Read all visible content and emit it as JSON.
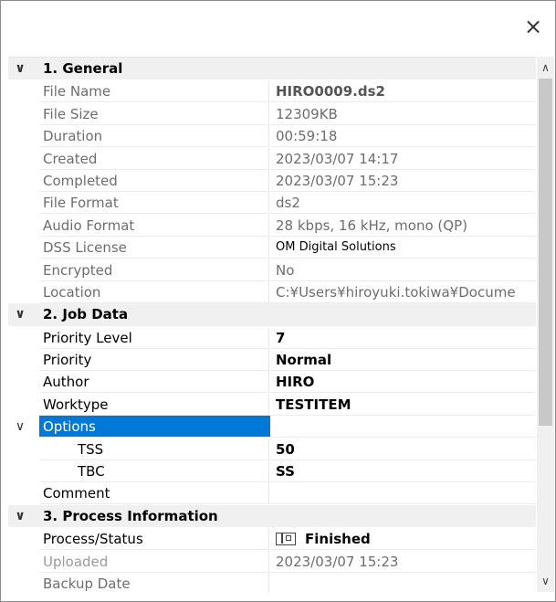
{
  "window": {
    "close_icon": "×"
  },
  "general": {
    "label": "1. General",
    "rows": [
      {
        "name": "File Name",
        "value": "HIRO0009.ds2"
      },
      {
        "name": "File Size",
        "value": "12309KB"
      },
      {
        "name": "Duration",
        "value": "00:59:18"
      },
      {
        "name": "Created",
        "value": "2023/03/07 14:17"
      },
      {
        "name": "Completed",
        "value": "2023/03/07 15:23"
      },
      {
        "name": "File Format",
        "value": "ds2"
      },
      {
        "name": "Audio Format",
        "value": "28 kbps, 16 kHz, mono (QP)"
      },
      {
        "name": "DSS License",
        "value": "OM Digital Solutions"
      },
      {
        "name": "Encrypted",
        "value": "No"
      },
      {
        "name": "Location",
        "value": "C:¥Users¥hiroyuki.tokiwa¥Docume"
      }
    ]
  },
  "job": {
    "label": "2. Job Data",
    "rows": [
      {
        "name": "Priority Level",
        "value": "7"
      },
      {
        "name": "Priority",
        "value": "Normal"
      },
      {
        "name": "Author",
        "value": "HIRO"
      },
      {
        "name": "Worktype",
        "value": "TESTITEM"
      }
    ],
    "options": {
      "label": "Options",
      "rows": [
        {
          "name": "TSS",
          "value": "50"
        },
        {
          "name": "TBC",
          "value": "SS"
        }
      ]
    },
    "comment": {
      "name": "Comment",
      "value": ""
    }
  },
  "process": {
    "label": "3. Process Information",
    "rows": [
      {
        "name": "Process/Status",
        "value": "Finished",
        "icon": "document-status-icon"
      },
      {
        "name": "Uploaded",
        "value": "2023/03/07 15:23"
      },
      {
        "name": "Backup Date",
        "value": ""
      }
    ]
  },
  "colors": {
    "selection": "#0078d7",
    "category_bg": "#f0f0f0"
  }
}
